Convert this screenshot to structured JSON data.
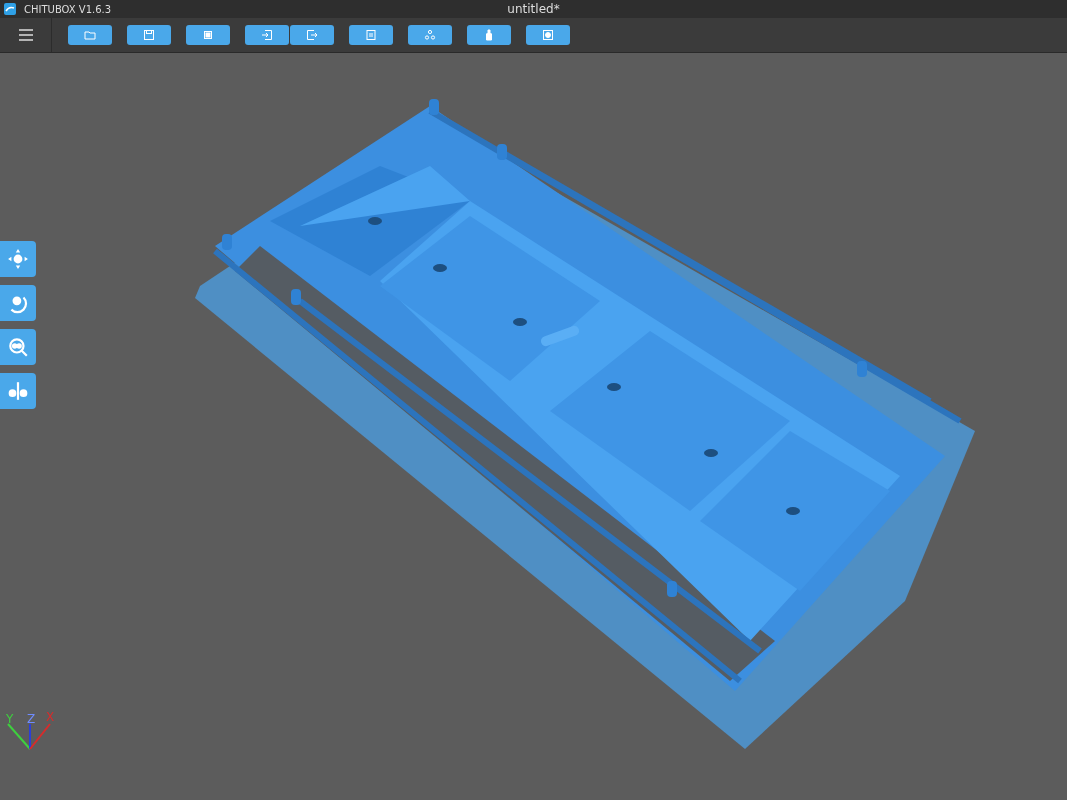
{
  "window": {
    "app_title": "CHITUBOX V1.6.3",
    "document_title": "untitled*"
  },
  "toolbar": {
    "groups": [
      [
        {
          "kind": "folder"
        }
      ],
      [
        {
          "kind": "save"
        }
      ],
      [
        {
          "kind": "frame"
        }
      ],
      [
        {
          "kind": "enter"
        },
        {
          "kind": "exit"
        }
      ],
      [
        {
          "kind": "document"
        }
      ],
      [
        {
          "kind": "nodes"
        }
      ],
      [
        {
          "kind": "bottle"
        }
      ],
      [
        {
          "kind": "square"
        }
      ]
    ]
  },
  "side_tools": [
    {
      "kind": "move"
    },
    {
      "kind": "rotate"
    },
    {
      "kind": "scale"
    },
    {
      "kind": "mirror"
    }
  ],
  "axes": {
    "x": "X",
    "y": "Y",
    "z": "Z"
  }
}
